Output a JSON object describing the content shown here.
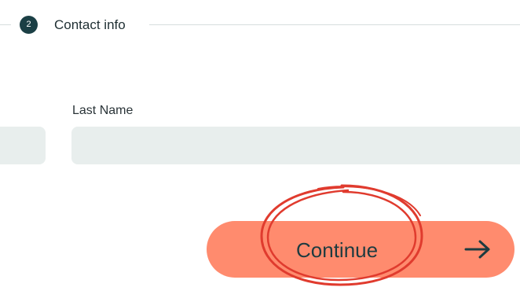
{
  "step": {
    "number": "2",
    "label": "Contact info"
  },
  "form": {
    "first_name_value": "",
    "last_name_label": "Last Name",
    "last_name_value": ""
  },
  "actions": {
    "continue_label": "Continue",
    "arrow_icon": "arrow-right-icon"
  },
  "colors": {
    "step_badge": "#1b3f45",
    "input_bg": "#e8eeed",
    "button_bg": "#ff8b6e",
    "button_text": "#1d3b40",
    "annotation": "#e03b2e"
  },
  "annotation": {
    "type": "hand-drawn-circle",
    "target": "continue-label"
  }
}
